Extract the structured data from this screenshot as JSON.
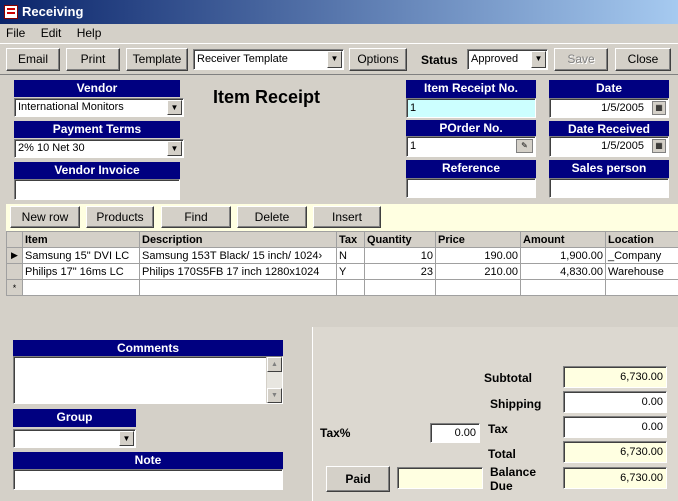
{
  "window": {
    "title": "Receiving"
  },
  "menu": [
    "File",
    "Edit",
    "Help"
  ],
  "toolbar": {
    "email_label": "Email",
    "print_label": "Print",
    "template_label": "Template",
    "template_value": "Receiver Template",
    "options_label": "Options",
    "status_label": "Status",
    "status_value": "Approved",
    "save_label": "Save",
    "close_label": "Close"
  },
  "form": {
    "heading": "Item Receipt",
    "vendor_label": "Vendor",
    "vendor_value": "International Monitors",
    "payment_terms_label": "Payment Terms",
    "payment_terms_value": "2% 10 Net 30",
    "vendor_invoice_label": "Vendor Invoice",
    "vendor_invoice_value": "",
    "item_receipt_no_label": "Item Receipt No.",
    "item_receipt_no_value": "1",
    "porder_no_label": "POrder No.",
    "porder_no_value": "1",
    "reference_label": "Reference",
    "reference_value": "",
    "date_label": "Date",
    "date_value": "1/5/2005",
    "date_received_label": "Date Received",
    "date_received_value": "1/5/2005",
    "salesperson_label": "Sales person",
    "salesperson_value": ""
  },
  "actions": {
    "new_row": "New row",
    "products": "Products",
    "find": "Find",
    "delete": "Delete",
    "insert": "Insert"
  },
  "grid": {
    "columns": [
      "Item",
      "Description",
      "Tax",
      "Quantity",
      "Price",
      "Amount",
      "Location"
    ],
    "rows": [
      [
        "Samsung 15\" DVI LC",
        "Samsung 153T Black/ 15 inch/ 1024›",
        "N",
        "10",
        "190.00",
        "1,900.00",
        "_Company"
      ],
      [
        "Philips 17\" 16ms LC",
        "Philips 170S5FB 17 inch 1280x1024",
        "Y",
        "23",
        "210.00",
        "4,830.00",
        "Warehouse"
      ]
    ],
    "new_row_marker": "*",
    "current_row_marker": "▶"
  },
  "bottom": {
    "comments_label": "Comments",
    "comments_value": "",
    "group_label": "Group",
    "group_value": "",
    "note_label": "Note",
    "note_value": "",
    "taxpct_label": "Tax%",
    "taxpct_value": "0.00",
    "paid_label": "Paid",
    "paid_value": "",
    "subtotal_label": "Subtotal",
    "subtotal_value": "6,730.00",
    "shipping_label": "Shipping",
    "shipping_value": "0.00",
    "tax_label": "Tax",
    "tax_value": "0.00",
    "total_label": "Total",
    "total_value": "6,730.00",
    "balance_label_1": "Balance",
    "balance_label_2": "Due",
    "balance_value": "6,730.00"
  }
}
